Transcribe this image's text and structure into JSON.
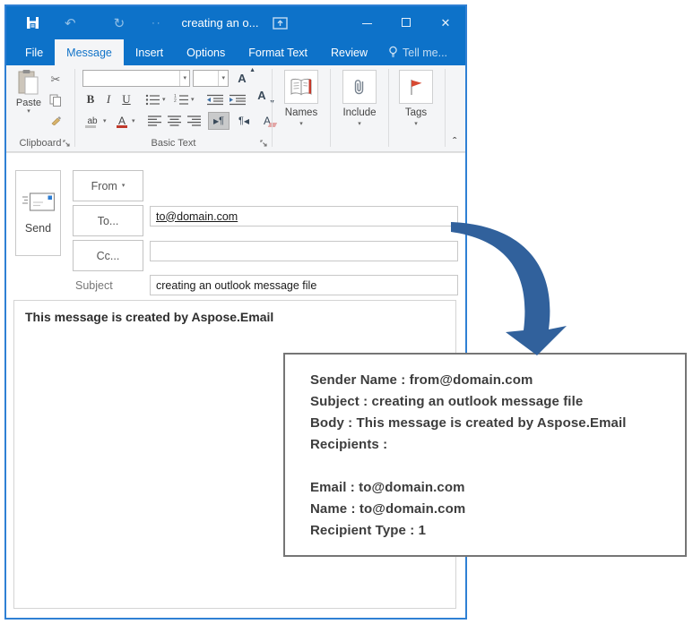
{
  "colors": {
    "titlebar_blue": "#0d72c9",
    "active_tab_text": "#1173c8",
    "window_border": "#2f80d4",
    "arrow_blue": "#31619c",
    "flag_red": "#d64a33"
  },
  "titlebar": {
    "title": "creating an o..."
  },
  "tabs": {
    "file": "File",
    "message": "Message",
    "insert": "Insert",
    "options": "Options",
    "format_text": "Format Text",
    "review": "Review",
    "tell_me": "Tell me..."
  },
  "ribbon": {
    "paste_label": "Paste",
    "clipboard_group_label": "Clipboard",
    "bold": "B",
    "italic": "I",
    "underline": "U",
    "basic_text_group_label": "Basic Text",
    "names_label": "Names",
    "include_label": "Include",
    "tags_label": "Tags"
  },
  "compose": {
    "send_label": "Send",
    "from_label": "From",
    "to_label": "To...",
    "cc_label": "Cc...",
    "subject_label": "Subject",
    "to_value": "to@domain.com",
    "cc_value": "",
    "subject_value": "creating an outlook message file",
    "body_text": "This message is created by Aspose.Email"
  },
  "output_box": {
    "lines": [
      "Sender Name : from@domain.com",
      "Subject : creating an outlook message file",
      "Body : This message is created by Aspose.Email",
      "Recipients :",
      "",
      "Email : to@domain.com",
      "Name : to@domain.com",
      "Recipient Type : 1"
    ]
  }
}
